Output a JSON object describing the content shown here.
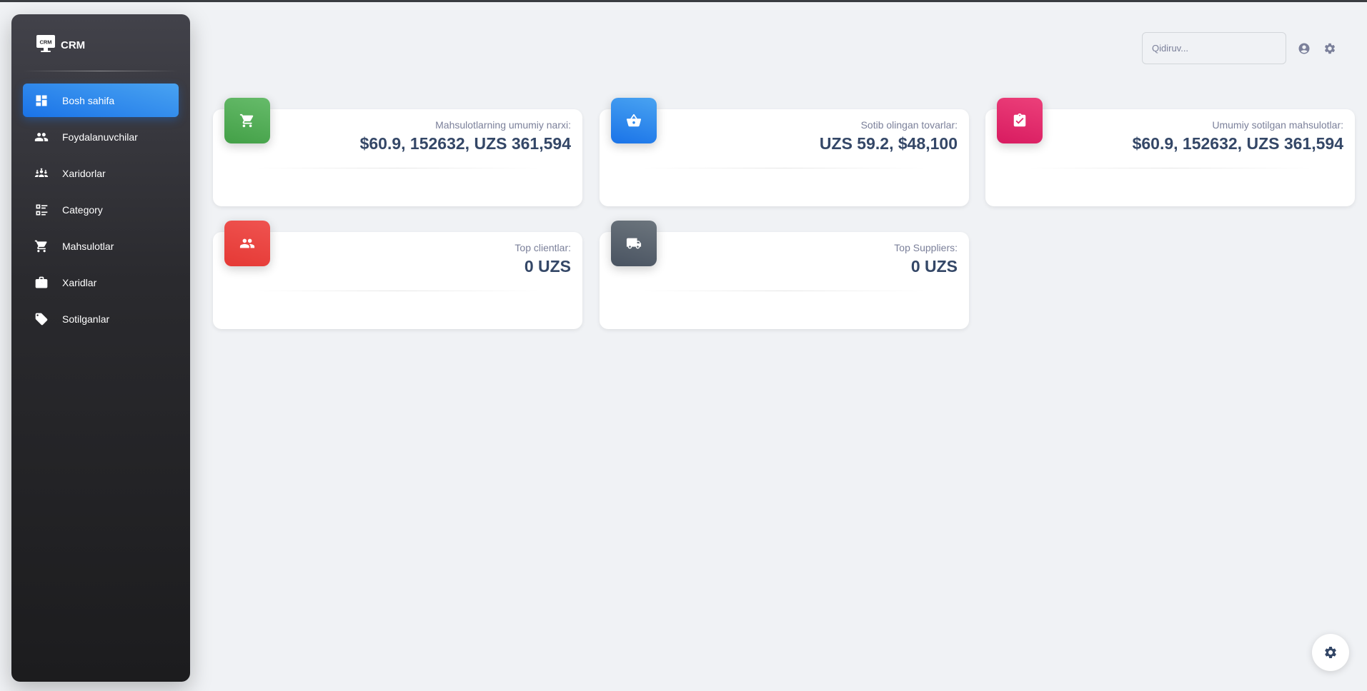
{
  "brand": {
    "name": "CRM",
    "logo_icon": "crm-monitor-icon"
  },
  "sidebar": {
    "items": [
      {
        "label": "Bosh sahifa",
        "icon": "dashboard-icon",
        "active": true
      },
      {
        "label": "Foydalanuvchilar",
        "icon": "people-icon",
        "active": false
      },
      {
        "label": "Xaridorlar",
        "icon": "groups-icon",
        "active": false
      },
      {
        "label": "Category",
        "icon": "category-list-icon",
        "active": false
      },
      {
        "label": "Mahsulotlar",
        "icon": "cart-icon",
        "active": false
      },
      {
        "label": "Xaridlar",
        "icon": "shopping-bag-icon",
        "active": false
      },
      {
        "label": "Sotilganlar",
        "icon": "tag-icon",
        "active": false
      }
    ]
  },
  "header": {
    "search": {
      "placeholder": "Qidiruv...",
      "value": ""
    },
    "icons": [
      "account-icon",
      "settings-icon"
    ]
  },
  "cards": [
    {
      "label": "Mahsulotlarning umumiy narxi:",
      "value": "$60.9, 152632, UZS 361,594",
      "icon": "cart-icon",
      "color": "#4caf50"
    },
    {
      "label": "Sotib olingan tovarlar:",
      "value": "UZS 59.2, $48,100",
      "icon": "basket-icon",
      "color": "#1a73e8"
    },
    {
      "label": "Umumiy sotilgan mahsulotlar:",
      "value": "$60.9, 152632, UZS 361,594",
      "icon": "clipboard-check-icon",
      "color": "#e91e63"
    },
    {
      "label": "Top clientlar:",
      "value": "0 UZS",
      "icon": "people-icon",
      "color": "#e53935"
    },
    {
      "label": "Top Suppliers:",
      "value": "0 UZS",
      "icon": "truck-icon",
      "color": "#495361"
    }
  ],
  "fab": {
    "icon": "settings-icon"
  }
}
